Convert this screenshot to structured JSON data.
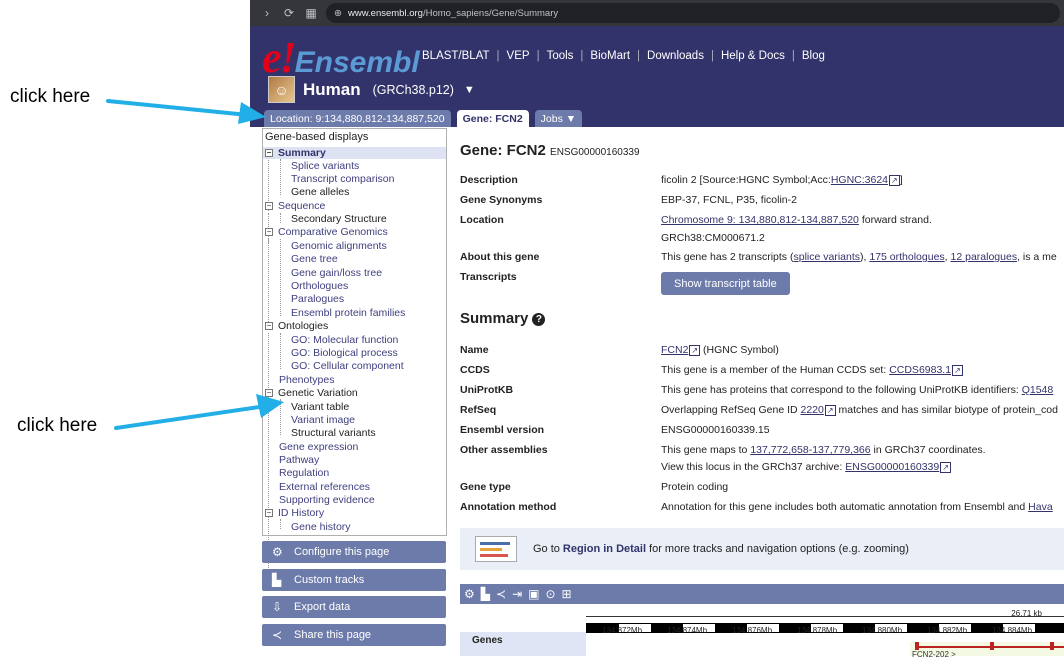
{
  "annotations": {
    "top": "click here",
    "bottom": "click here",
    "arrow_color": "#22aee6"
  },
  "browser": {
    "url_host": "www.ensembl.org",
    "url_path": "/Homo_sapiens/Gene/Summary"
  },
  "header": {
    "logo_mark": "e!",
    "logo_text": "Ensembl",
    "nav": [
      "BLAST/BLAT",
      "VEP",
      "Tools",
      "BioMart",
      "Downloads",
      "Help & Docs",
      "Blog"
    ],
    "species": "Human",
    "assembly": "(GRCh38.p12)",
    "tabs": {
      "location": "Location: 9:134,880,812-134,887,520",
      "gene": "Gene: FCN2",
      "jobs": "Jobs"
    }
  },
  "sidebar": {
    "heading": "Gene-based displays",
    "items": [
      "Summary",
      "Splice variants",
      "Transcript comparison",
      "Gene alleles",
      "Sequence",
      "Secondary Structure",
      "Comparative Genomics",
      "Genomic alignments",
      "Gene tree",
      "Gene gain/loss tree",
      "Orthologues",
      "Paralogues",
      "Ensembl protein families",
      "Ontologies",
      "GO: Molecular function",
      "GO: Biological process",
      "GO: Cellular component",
      "Phenotypes",
      "Genetic Variation",
      "Variant table",
      "Variant image",
      "Structural variants",
      "Gene expression",
      "Pathway",
      "Regulation",
      "External references",
      "Supporting evidence",
      "ID History",
      "Gene history"
    ],
    "buttons": [
      "Configure this page",
      "Custom tracks",
      "Export data",
      "Share this page"
    ]
  },
  "gene": {
    "title": "Gene: FCN2",
    "id": "ENSG00000160339",
    "description_label": "Description",
    "description_value": "ficolin 2 [Source:HGNC Symbol;Acc:",
    "description_link": "HGNC:3624",
    "synonyms_label": "Gene Synonyms",
    "synonyms_value": "EBP-37, FCNL, P35, ficolin-2",
    "location_label": "Location",
    "location_link": "Chromosome 9: 134,880,812-134,887,520",
    "location_rest": "forward strand.",
    "location_line2": "GRCh38:CM000671.2",
    "about_label": "About this gene",
    "about_text": "This gene has 2 transcripts (",
    "about_link1": "splice variants",
    "about_link2": "175 orthologues",
    "about_link3": "12 paralogues",
    "about_tail": ", is a me",
    "transcripts_label": "Transcripts",
    "transcripts_button": "Show transcript table"
  },
  "summary": {
    "title": "Summary",
    "name_label": "Name",
    "name_link": "FCN2",
    "name_rest": "(HGNC Symbol)",
    "ccds_label": "CCDS",
    "ccds_text": "This gene is a member of the Human CCDS set:",
    "ccds_link": "CCDS6983.1",
    "uniprot_label": "UniProtKB",
    "uniprot_text": "This gene has proteins that correspond to the following UniProtKB identifiers:",
    "uniprot_link": "Q1548",
    "refseq_label": "RefSeq",
    "refseq_text1": "Overlapping RefSeq Gene ID",
    "refseq_link": "2220",
    "refseq_text2": "matches and has similar biotype of protein_cod",
    "version_label": "Ensembl version",
    "version_value": "ENSG00000160339.15",
    "other_label": "Other assemblies",
    "other_text1": "This gene maps to",
    "other_link": "137,772,658-137,779,366",
    "other_text2": "in GRCh37 coordinates.",
    "other_line2": "View this locus in the GRCh37 archive:",
    "other_link2": "ENSG00000160339",
    "type_label": "Gene type",
    "type_value": "Protein coding",
    "annot_label": "Annotation method",
    "annot_text": "Annotation for this gene includes both automatic annotation from Ensembl and",
    "annot_link": "Hava"
  },
  "region": {
    "text1": "Go to",
    "link": "Region in Detail",
    "text2": "for more tracks and navigation options (e.g. zooming)"
  },
  "genome_view": {
    "scale": "26.71 kb",
    "ticks": [
      "134.872Mb",
      "134.874Mb",
      "134.876Mb",
      "134.878Mb",
      "134.880Mb",
      "134.882Mb",
      "134.884Mb"
    ],
    "track_label": "Genes",
    "transcript_label": "FCN2-202 >"
  }
}
